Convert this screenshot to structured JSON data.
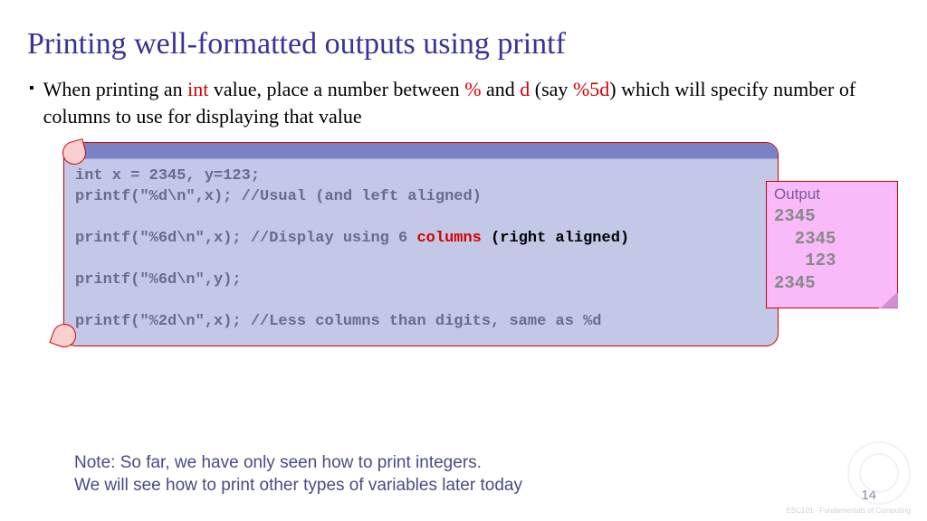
{
  "title": "Printing well-formatted outputs using printf",
  "bullet": {
    "pre": "When printing an ",
    "int": "int",
    "mid1": " value, place a number between ",
    "pct": "%",
    "mid2": " and ",
    "d": "d",
    "mid3": " (say ",
    "ex": "%5d",
    "post": ") which will specify number of columns to use for displaying that value"
  },
  "code": {
    "l1": "int x = 2345, y=123;",
    "l2": "printf(\"%d\\n\",x); //Usual (and left aligned)",
    "l3a": "printf(\"%6d\\n\",x); //Display using 6 ",
    "l3b": "columns",
    "l3c": " (right aligned)",
    "l4": "printf(\"%6d\\n\",y);",
    "l5": "printf(\"%2d\\n\",x); //Less columns than digits, same as %d"
  },
  "output": {
    "title": "Output",
    "body": "2345\n  2345\n   123\n2345"
  },
  "note": {
    "l1": "Note: So far, we have only seen how to print integers.",
    "l2": "We will see how to print other types of variables later today"
  },
  "page": "14",
  "wm": "ESC101 · Fundamentals\nof Computing"
}
